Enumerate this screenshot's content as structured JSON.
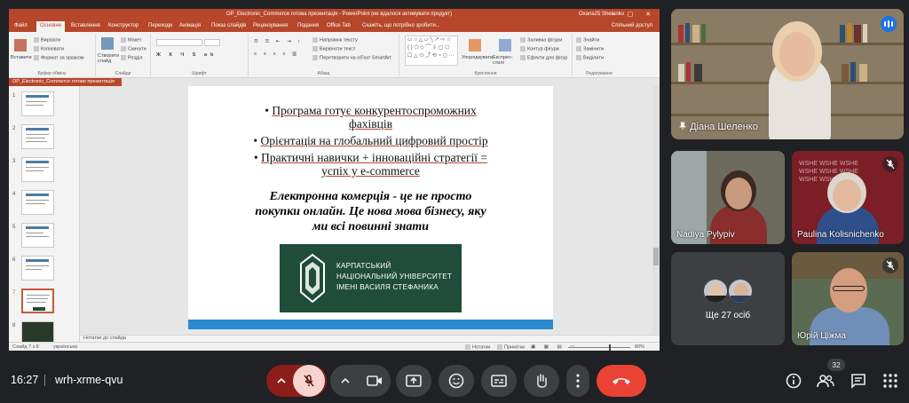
{
  "ppt": {
    "title": "OP_Electronic_Commerce готова презентація  -  PowerPoint (не вдалося активувати продукт)",
    "user": "Oxana25 Shelenko",
    "tabs": [
      "Файл",
      "Основне",
      "Вставлення",
      "Конструктор",
      "Переходи",
      "Анімація",
      "Показ слайдів",
      "Рецензування",
      "Подання",
      "Office Tab",
      "Скажіть, що потрібно зробити..."
    ],
    "active_tab": "Основне",
    "share": "Спільний доступ",
    "ribbon": {
      "paste": "Вставити",
      "cut": "Вирізати",
      "copy": "Копіювати",
      "format_painter": "Формат за зразком",
      "clipboard_group": "Буфер обміну",
      "new_slide": "Створити слайд",
      "layout": "Макет",
      "reset": "Скинути",
      "section": "Розділ",
      "slides_group": "Слайди",
      "font_group": "Шрифт",
      "text_direction": "Напрямок тексту",
      "align_text": "Вирівняти текст",
      "convert_smartart": "Перетворити на об'єкт SmartArt",
      "paragraph_group": "Абзац",
      "arrange": "Упорядкувати",
      "quick_styles": "Експрес-стилі",
      "shape_fill": "Заливка фігури",
      "shape_outline": "Контур фігури",
      "shape_effects": "Ефекти для фігур",
      "drawing_group": "Креслення",
      "find": "Знайти",
      "replace": "Замінити",
      "select": "Виділити",
      "editing_group": "Редагування"
    },
    "file_tab": "OP_Electronic_Commerce готово презентація",
    "slide": {
      "bullet1_a": "Програма готує конкурентоспроможних",
      "bullet1_b": "фахівців",
      "bullet2": "Орієнтація на глобальний цифровий простір",
      "bullet3_a": "Практичні навички + інноваційні стратегії =",
      "bullet3_b": "успіх у e-commerce",
      "statement_1": "Електронна комерція - це не просто",
      "statement_2": "покупки онлайн. Це нова мова бізнесу, яку",
      "statement_3": "ми всі повинні знати",
      "logo_1": "КАРПАТСЬКИЙ",
      "logo_2": "НАЦІОНАЛЬНИЙ УНІВЕРСИТЕТ",
      "logo_3": "ІМЕНІ ВАСИЛЯ СТЕФАНИКА"
    },
    "thumbnail_numbers": [
      "1",
      "2",
      "3",
      "4",
      "5",
      "6",
      "7",
      "8"
    ],
    "active_slide": 7,
    "notes_placeholder": "Нотатки до слайда",
    "status": {
      "slide_of": "Слайд 7 з 8",
      "language": "українська",
      "notes_btn": "Нотатки",
      "comments_btn": "Примітки",
      "zoom": "80%"
    }
  },
  "participants": {
    "main_speaker": "Діана Шеленко",
    "p2": "Nadiya Pylypiv",
    "p3": "Paulina Kolisnichenko",
    "others": "Ще 27 осіб",
    "p5": "Юрій Ціжма"
  },
  "meeting": {
    "time": "16:27",
    "code": "wrh-xrme-qvu",
    "participant_count": "32"
  },
  "colors": {
    "ppt_accent": "#b7472a",
    "meet_bg": "#202124",
    "end_call": "#ea4335",
    "mic_off": "#f6d3d0",
    "logo_green": "#1f4d3a"
  }
}
